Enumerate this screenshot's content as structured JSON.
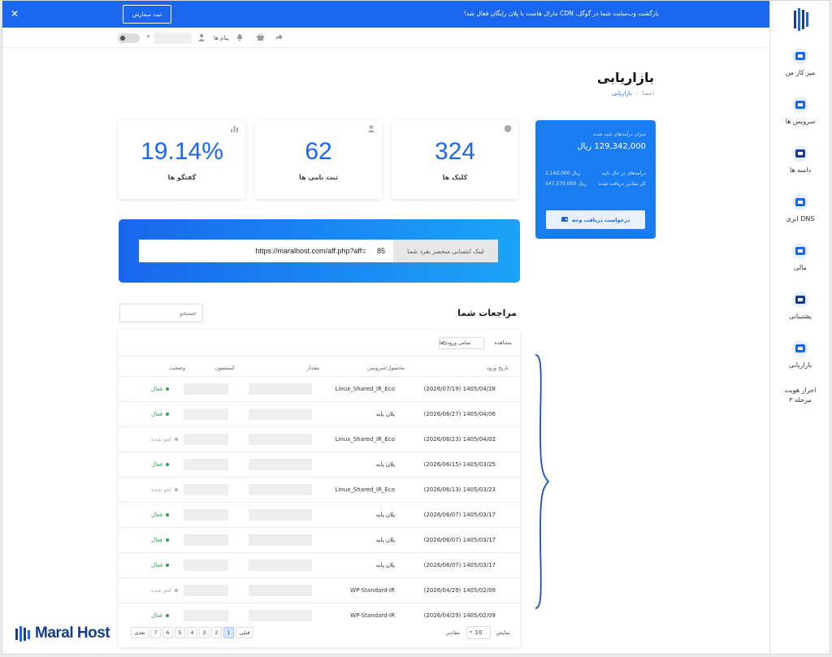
{
  "banner": {
    "text": "بازگشت وب‌سایت شما در گوگل، CDN مارال هاست با پلان رایگان فعال شد!",
    "button": "ثبت سفارش"
  },
  "topbar": {
    "messages": "پیام ها"
  },
  "sidebar": {
    "items": [
      {
        "label": "میز کار من",
        "icon": "dashboard-icon"
      },
      {
        "label": "سرویس ها",
        "icon": "services-icon"
      },
      {
        "label": "دامنه ها",
        "icon": "domains-icon"
      },
      {
        "label": "DNS ابری",
        "icon": "cloud-dns-icon"
      },
      {
        "label": "مالی",
        "icon": "finance-icon"
      },
      {
        "label": "پشتیبانی",
        "icon": "support-icon"
      },
      {
        "label": "بازاریابی",
        "icon": "marketing-icon"
      }
    ],
    "verify": [
      "احراز هویت",
      "مرحله ۳"
    ]
  },
  "page": {
    "title": "بازاریابی",
    "breadcrumb": [
      "اعضا",
      "بازاریابی"
    ]
  },
  "stats": [
    {
      "value": "324",
      "label": "کلیک ها",
      "icon": "shield-icon"
    },
    {
      "value": "62",
      "label": "ثبت نامی ها",
      "icon": "user-icon"
    },
    {
      "value": "19.14%",
      "label": "گفتگو ها",
      "icon": "bar-chart-icon"
    }
  ],
  "balance": {
    "caption": "میزان درآمدهای تایید شده",
    "amount": "129,342,000 ریال",
    "pending_label": "درآمدهای در حال تایید",
    "pending_value": "2,142,000 ریال",
    "withdrawn_label": "کل مقادیر دریافت شده",
    "withdrawn_value": "547,570,000 ریال",
    "button": "درخواست دریافت وجه"
  },
  "link": {
    "label": "لینک انتصابی منحصر بفرد شما",
    "url": "https://maralhost.com/aff.php?aff=   85"
  },
  "referrals": {
    "title": "مراجعات شما",
    "search_placeholder": "جستجو",
    "filter_label": "مشاهده",
    "filter_value": "تمامی ورودی‌ها",
    "columns": [
      "تاریخ ورود",
      "محصول/سرویس",
      "مقدار",
      "کمیسیون",
      "وضعیت"
    ],
    "rows": [
      {
        "date": "(2026/07/19) 1405/04/28",
        "product": "Linux_Shared_IR_Eco",
        "status": "فعال",
        "active": true
      },
      {
        "date": "(2026/06/27) 1405/04/06",
        "product": "پلان پایه",
        "status": "فعال",
        "active": true
      },
      {
        "date": "(2026/06/23) 1405/04/02",
        "product": "Linux_Shared_IR_Eco",
        "status": "لغو شده",
        "active": false
      },
      {
        "date": "(2026/06/15) 1405/03/25",
        "product": "پلان پایه",
        "status": "فعال",
        "active": true
      },
      {
        "date": "(2026/06/13) 1405/03/23",
        "product": "Linux_Shared_IR_Eco",
        "status": "لغو شده",
        "active": false
      },
      {
        "date": "(2026/06/07) 1405/03/17",
        "product": "پلان پایه",
        "status": "فعال",
        "active": true
      },
      {
        "date": "(2026/06/07) 1405/03/17",
        "product": "پلان پایه",
        "status": "فعال",
        "active": true
      },
      {
        "date": "(2026/06/07) 1405/03/17",
        "product": "پلان پایه",
        "status": "فعال",
        "active": true
      },
      {
        "date": "(2026/04/29) 1405/02/09",
        "product": "WP-Standard-IR",
        "status": "لغو شده",
        "active": false
      },
      {
        "date": "(2026/04/29) 1405/02/09",
        "product": "WP-Standard-IR",
        "status": "فعال",
        "active": true
      }
    ],
    "show_label": "نمایش",
    "show_value": "10",
    "items_label": "مقادیر",
    "pagination": [
      "بعدی",
      "7",
      "6",
      "5",
      "4",
      "3",
      "2",
      "1",
      "قبلی"
    ],
    "active_page": "1"
  },
  "logo": {
    "text": "Maral Host"
  },
  "colors": {
    "primary": "#1a66ee",
    "active": "#2e9e4f",
    "cancelled": "#b0b0b0"
  }
}
